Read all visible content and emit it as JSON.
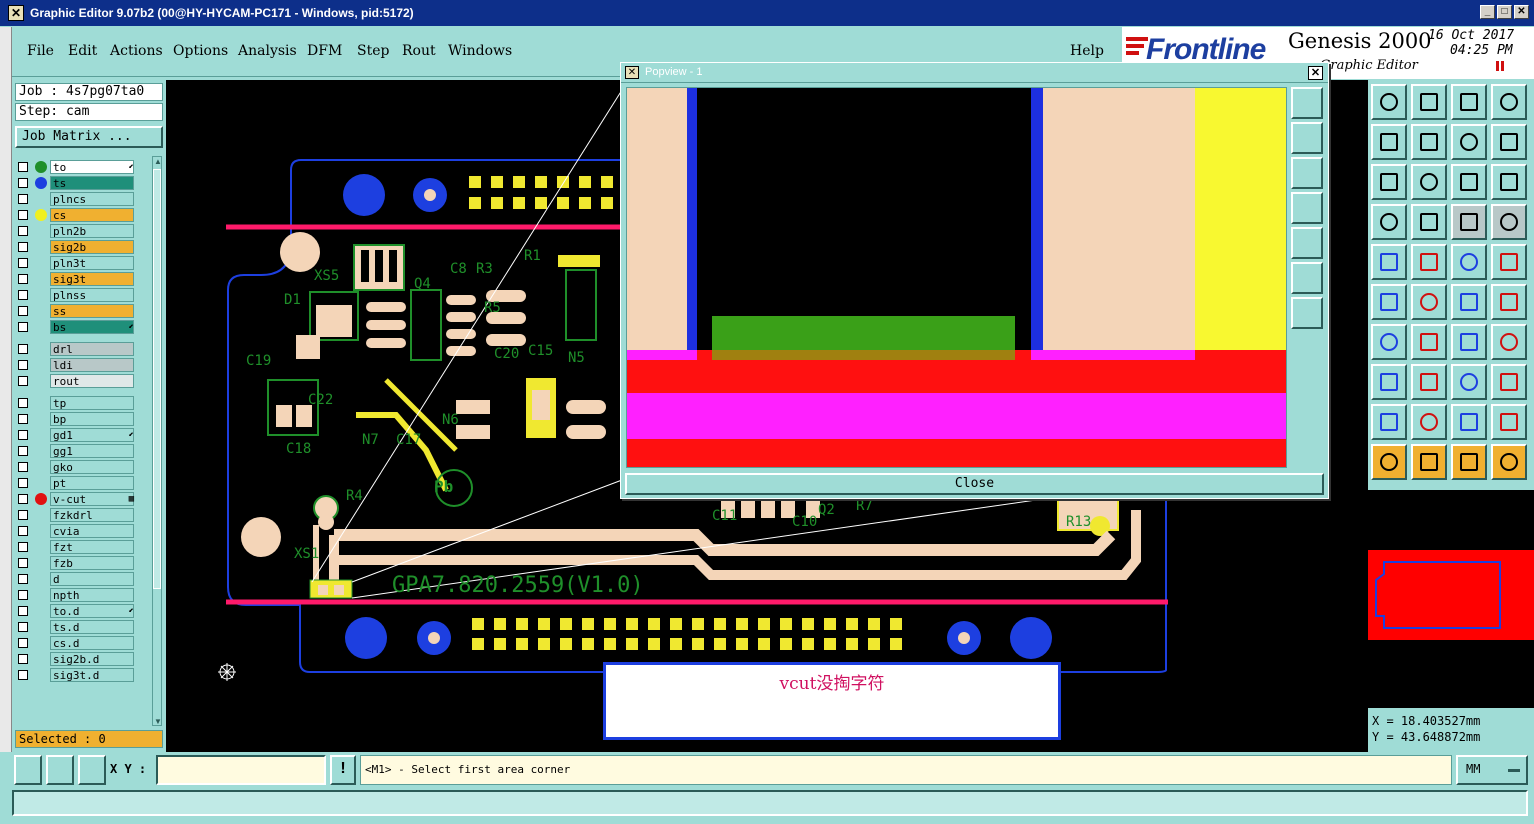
{
  "window": {
    "title": "Graphic Editor 9.07b2 (00@HY-HYCAM-PC171 - Windows, pid:5172)"
  },
  "menu": {
    "items": [
      "File",
      "Edit",
      "Actions",
      "Options",
      "Analysis",
      "DFM",
      "Step",
      "Rout",
      "Windows"
    ],
    "help": "Help"
  },
  "brand": {
    "logo": "Frontline",
    "product": "Genesis 2000",
    "subtitle": "Graphic Editor",
    "date": "16 Oct 2017",
    "time": "04:25 PM"
  },
  "job": {
    "job_line": "Job : 4s7pg07ta0",
    "step_line": "Step: cam",
    "matrix_button": "Job Matrix ..."
  },
  "layers": [
    {
      "name": "to",
      "bg": "#ffffff",
      "dot": "#1f8f2a",
      "mark": "⬋"
    },
    {
      "name": "ts",
      "bg": "#1f8f7a",
      "dot": "#1d3fe0",
      "mark": ""
    },
    {
      "name": "plncs",
      "bg": "#9fdcd6",
      "dot": "",
      "mark": ""
    },
    {
      "name": "cs",
      "bg": "#f0b030",
      "dot": "#f0f020",
      "mark": ""
    },
    {
      "name": "pln2b",
      "bg": "#9fdcd6",
      "dot": "",
      "mark": ""
    },
    {
      "name": "sig2b",
      "bg": "#f0b030",
      "dot": "",
      "mark": ""
    },
    {
      "name": "pln3t",
      "bg": "#9fdcd6",
      "dot": "",
      "mark": ""
    },
    {
      "name": "sig3t",
      "bg": "#f0b030",
      "dot": "",
      "mark": ""
    },
    {
      "name": "plnss",
      "bg": "#9fdcd6",
      "dot": "",
      "mark": ""
    },
    {
      "name": "ss",
      "bg": "#f0b030",
      "dot": "",
      "mark": ""
    },
    {
      "name": "bs",
      "bg": "#1f8f7a",
      "dot": "",
      "mark": "⬋"
    },
    {
      "name": "drl",
      "bg": "#b8c8c8",
      "dot": "",
      "mark": ""
    },
    {
      "name": "ldi",
      "bg": "#b8c8c8",
      "dot": "",
      "mark": ""
    },
    {
      "name": "rout",
      "bg": "#e0e8e8",
      "dot": "",
      "mark": ""
    },
    {
      "name": "tp",
      "bg": "#9fdcd6",
      "dot": "",
      "mark": ""
    },
    {
      "name": "bp",
      "bg": "#9fdcd6",
      "dot": "",
      "mark": ""
    },
    {
      "name": "gd1",
      "bg": "#9fdcd6",
      "dot": "",
      "mark": "⬋"
    },
    {
      "name": "gg1",
      "bg": "#9fdcd6",
      "dot": "",
      "mark": ""
    },
    {
      "name": "gko",
      "bg": "#9fdcd6",
      "dot": "",
      "mark": ""
    },
    {
      "name": "pt",
      "bg": "#9fdcd6",
      "dot": "",
      "mark": ""
    },
    {
      "name": "v-cut",
      "bg": "#9fdcd6",
      "dot": "#e01010",
      "mark": "▦"
    },
    {
      "name": "fzkdrl",
      "bg": "#9fdcd6",
      "dot": "",
      "mark": ""
    },
    {
      "name": "cvia",
      "bg": "#9fdcd6",
      "dot": "",
      "mark": ""
    },
    {
      "name": "fzt",
      "bg": "#9fdcd6",
      "dot": "",
      "mark": ""
    },
    {
      "name": "fzb",
      "bg": "#9fdcd6",
      "dot": "",
      "mark": ""
    },
    {
      "name": "d",
      "bg": "#9fdcd6",
      "dot": "",
      "mark": ""
    },
    {
      "name": "npth",
      "bg": "#9fdcd6",
      "dot": "",
      "mark": ""
    },
    {
      "name": "to.d",
      "bg": "#9fdcd6",
      "dot": "",
      "mark": "⬋"
    },
    {
      "name": "ts.d",
      "bg": "#9fdcd6",
      "dot": "",
      "mark": ""
    },
    {
      "name": "cs.d",
      "bg": "#9fdcd6",
      "dot": "",
      "mark": ""
    },
    {
      "name": "sig2b.d",
      "bg": "#9fdcd6",
      "dot": "",
      "mark": ""
    },
    {
      "name": "sig3t.d",
      "bg": "#9fdcd6",
      "dot": "",
      "mark": ""
    }
  ],
  "selected": "Selected : 0",
  "popview": {
    "title": "Popview - 1",
    "close_button": "Close"
  },
  "board": {
    "silk_text": "GPA7.820.2559(V1.0)",
    "refdes": [
      "XS5",
      "D1",
      "Q4",
      "C8",
      "R3",
      "R1",
      "R5",
      "C19",
      "C22",
      "C18",
      "N7",
      "C17",
      "N6",
      "C20",
      "C15",
      "N5",
      "R4",
      "XS1",
      "C10",
      "Q2",
      "R7",
      "R13",
      "C11"
    ]
  },
  "annotation": "vcut没掏字符",
  "coords": {
    "x": "X =  18.403527mm",
    "y": "Y =  43.648872mm"
  },
  "status": {
    "xy_label": "X Y :",
    "xy_value": "",
    "message": "<M1> - Select first area corner",
    "units": "MM"
  }
}
